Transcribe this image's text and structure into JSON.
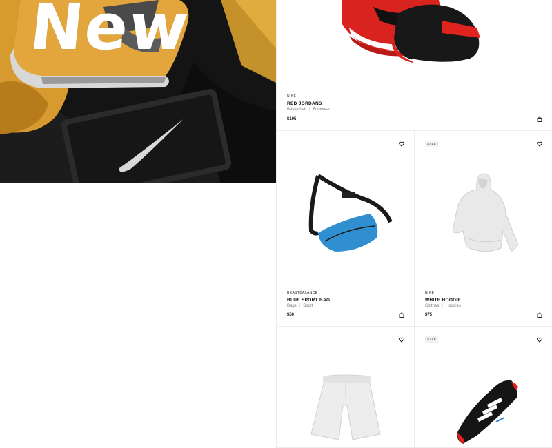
{
  "hero": {
    "title": "New",
    "icon": "swoosh-logo"
  },
  "colors": {
    "background": "#ffffff",
    "hero_dark": "#121212",
    "mustard": "#d69a2e",
    "accent_red": "#e3221f",
    "text": "#111111"
  },
  "products": [
    {
      "brand": "NIKE",
      "name": "RED JORDANS",
      "tags": [
        "Basketball",
        "Footwear"
      ],
      "price": "$105",
      "badge": ""
    },
    {
      "brand": "BEASTBALANCE",
      "name": "BLUE SPORT BAG",
      "tags": [
        "Bags",
        "Sport"
      ],
      "price": "$50",
      "badge": ""
    },
    {
      "brand": "NIKE",
      "name": "WHITE HOODIE",
      "tags": [
        "Clothes",
        "Hoodies"
      ],
      "price": "$75",
      "badge": "SALE"
    },
    {
      "brand": "",
      "name": "",
      "tags": [],
      "price": "",
      "badge": ""
    },
    {
      "brand": "",
      "name": "",
      "tags": [],
      "price": "",
      "badge": "SALE"
    }
  ]
}
